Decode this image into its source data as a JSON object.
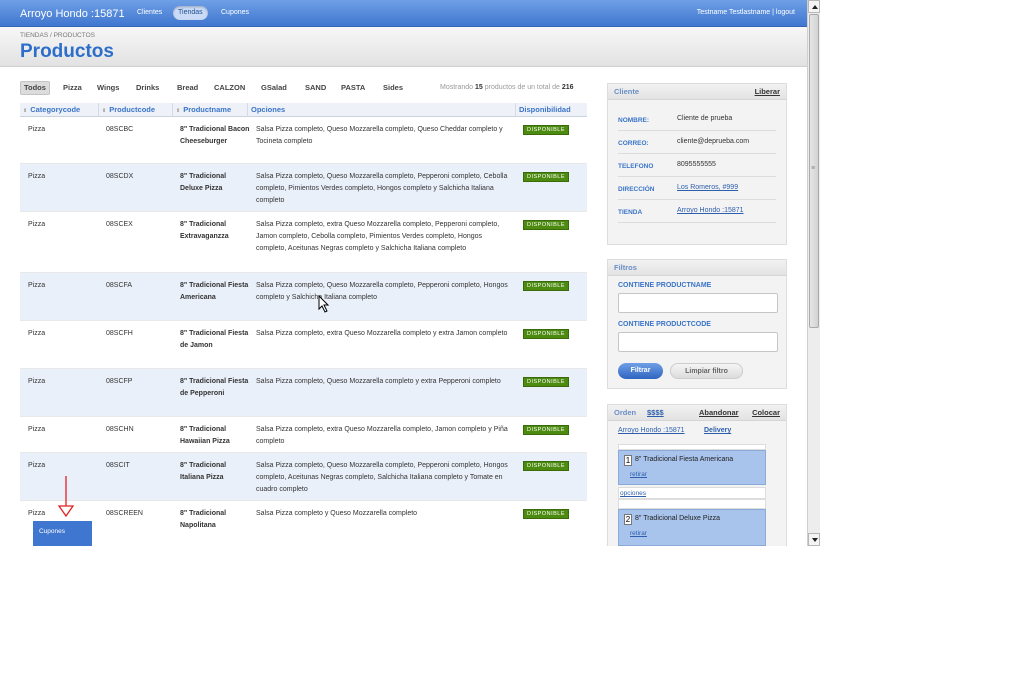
{
  "topbar": {
    "brand": "Arroyo Hondo :15871",
    "nav": [
      {
        "label": "Clientes",
        "active": false
      },
      {
        "label": "Tiendas",
        "active": true
      },
      {
        "label": "Cupones",
        "active": false
      }
    ],
    "user_nav": "Testname Testlastname | logout"
  },
  "header": {
    "breadcrumb": "TIENDAS / PRODUCTOS",
    "title": "Productos"
  },
  "category_tabs": [
    {
      "label": "Todos",
      "active": true
    },
    {
      "label": "Pizza",
      "active": false
    },
    {
      "label": "Wings",
      "active": false
    },
    {
      "label": "Drinks",
      "active": false
    },
    {
      "label": "Bread",
      "active": false
    },
    {
      "label": "CALZON",
      "active": false
    },
    {
      "label": "GSalad",
      "active": false
    },
    {
      "label": "SAND",
      "active": false
    },
    {
      "label": "PASTA",
      "active": false
    },
    {
      "label": "Sides",
      "active": false
    }
  ],
  "showing": {
    "prefix": "Mostrando",
    "count": "15",
    "middle": "productos de un total de",
    "total": "216"
  },
  "table": {
    "columns": [
      "Categorycode",
      "Productcode",
      "Productname",
      "Opciones",
      "Disponibilidad"
    ],
    "badge_label": "DISPONIBLE",
    "rows": [
      {
        "category": "Pizza",
        "code": "08SCBC",
        "name": "8\" Tradicional Bacon Cheeseburger",
        "options": "Salsa Pizza completo, Queso Mozzarella completo, Queso Cheddar completo y Tocineta completo"
      },
      {
        "category": "Pizza",
        "code": "08SCDX",
        "name": "8\" Tradicional Deluxe Pizza",
        "options": "Salsa Pizza completo, Queso Mozzarella completo, Pepperoni completo, Cebolla completo, Pimientos Verdes completo, Hongos completo y Salchicha Italiana completo"
      },
      {
        "category": "Pizza",
        "code": "08SCEX",
        "name": "8\" Tradicional Extravaganzza",
        "options": "Salsa Pizza completo, extra Queso Mozzarella completo, Pepperoni completo, Jamon completo, Cebolla completo, Pimientos Verdes completo, Hongos completo, Aceitunas Negras completo y Salchicha Italiana completo"
      },
      {
        "category": "Pizza",
        "code": "08SCFA",
        "name": "8\" Tradicional Fiesta Americana",
        "options": "Salsa Pizza completo, Queso Mozzarella completo, Pepperoni completo, Hongos completo y Salchicha Italiana completo"
      },
      {
        "category": "Pizza",
        "code": "08SCFH",
        "name": "8\" Tradicional Fiesta de Jamon",
        "options": "Salsa Pizza completo, extra Queso Mozzarella completo y extra Jamon completo"
      },
      {
        "category": "Pizza",
        "code": "08SCFP",
        "name": "8\" Tradicional Fiesta de Pepperoni",
        "options": "Salsa Pizza completo, Queso Mozzarella completo y extra Pepperoni completo"
      },
      {
        "category": "Pizza",
        "code": "08SCHN",
        "name": "8\" Tradicional Hawaiian Pizza",
        "options": "Salsa Pizza completo, extra Queso Mozzarella completo, Jamon completo y Piña completo"
      },
      {
        "category": "Pizza",
        "code": "08SCIT",
        "name": "8\" Tradicional Italiana Pizza",
        "options": "Salsa Pizza completo, Queso Mozzarella completo, Pepperoni completo, Hongos completo, Aceitunas Negras completo, Salchicha Italiana completo y Tomate en cuadro completo"
      },
      {
        "category": "Pizza",
        "code": "08SCREEN",
        "name": "8\" Tradicional Napolitana",
        "options": "Salsa Pizza completo y Queso Mozzarella completo"
      }
    ]
  },
  "cliente_panel": {
    "title": "Cliente",
    "action": "Liberar",
    "fields": [
      {
        "key": "NOMBRE:",
        "value": "Cliente de prueba",
        "link": false
      },
      {
        "key": "CORREO:",
        "value": "cliente@deprueba.com",
        "link": false
      },
      {
        "key": "TELEFONO",
        "value": "8095555555",
        "link": false
      },
      {
        "key": "DIRECCIÓN",
        "value": "Los Romeros, #999",
        "link": true
      },
      {
        "key": "TIENDA",
        "value": "Arroyo Hondo :15871",
        "link": true
      }
    ]
  },
  "filtros_panel": {
    "title": "Filtros",
    "label_name": "CONTIENE PRODUCTNAME",
    "label_code": "CONTIENE PRODUCTCODE",
    "btn_filtrar": "Filtrar",
    "btn_limpiar": "Limpiar filtro"
  },
  "orden_panel": {
    "title": "Orden",
    "amount": "$$$$",
    "abandonar": "Abandonar",
    "colocar": "Colocar",
    "store": "Arroyo Hondo :15871",
    "delivery": "Delivery",
    "items": [
      {
        "qty": "1",
        "name": "8\" Tradicional Fiesta Americana",
        "retirar": "retirar"
      },
      {
        "qty": "2",
        "name": "8\" Tradicional Deluxe Pizza",
        "retirar": "retirar"
      }
    ],
    "opciones_label": "opciones"
  },
  "floating_button": "Cupones",
  "colors": {
    "brand_blue": "#3f76cf",
    "available_green": "#4d8b10",
    "row_alt": "#eaf0fa",
    "arrow_red": "#e02020"
  }
}
